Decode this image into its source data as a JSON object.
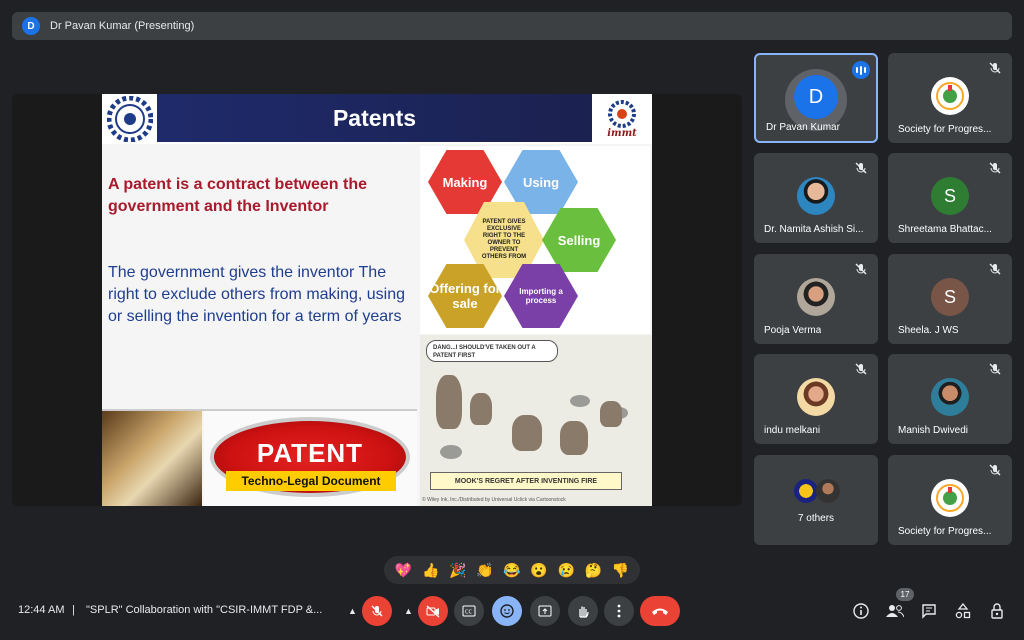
{
  "presenting_bar": {
    "avatar_letter": "D",
    "label": "Dr Pavan Kumar (Presenting)"
  },
  "slide": {
    "title": "Patents",
    "logo_right_text": "immt",
    "definition": "A patent is a contract between the government and the Inventor",
    "description": "The government gives the inventor The right to exclude others from making, using or selling the invention for a term of years",
    "hexagons": [
      {
        "label": "Making",
        "color": "#e53935"
      },
      {
        "label": "Using",
        "color": "#7ab3e8"
      },
      {
        "label": "Selling",
        "color": "#6abf3e"
      },
      {
        "label": "Offering for sale",
        "color": "#c9a227"
      },
      {
        "label": "Importing a process",
        "color": "#7b3fa8"
      }
    ],
    "hex_center": "PATENT GIVES EXCLUSIVE RIGHT TO THE OWNER TO PREVENT OTHERS FROM",
    "cartoon_bubble": "DANG...I SHOULD'VE TAKEN OUT A PATENT FIRST",
    "cartoon_caption": "MOOK'S REGRET AFTER INVENTING FIRE",
    "cartoon_credit": "© Wiley Ink, Inc./Distributed by Universal Uclick via Cartoonstock",
    "patent_badge": "PATENT",
    "patent_subtitle": "Techno-Legal Document"
  },
  "participants": [
    {
      "name": "Dr Pavan Kumar",
      "initial": "D",
      "avatar_color": "#1a73e8",
      "speaking": true
    },
    {
      "name": "Society for Progres...",
      "type": "logo",
      "muted": true
    },
    {
      "name": "Dr. Namita Ashish Si...",
      "type": "photo",
      "muted": true
    },
    {
      "name": "Shreetama Bhattac...",
      "initial": "S",
      "avatar_color": "#2e7d32",
      "muted": true
    },
    {
      "name": "Pooja Verma",
      "type": "photo",
      "muted": true
    },
    {
      "name": "Sheela. J WS",
      "initial": "S",
      "avatar_color": "#795548",
      "muted": true
    },
    {
      "name": "indu melkani",
      "type": "photo",
      "muted": true
    },
    {
      "name": "Manish Dwivedi",
      "type": "photo",
      "muted": true
    },
    {
      "name": "7 others",
      "type": "group"
    },
    {
      "name": "Society for Progres...",
      "type": "logo",
      "muted": true
    }
  ],
  "reactions": [
    "💖",
    "👍",
    "🎉",
    "👏",
    "😂",
    "😮",
    "😢",
    "🤔",
    "👎"
  ],
  "bottom_bar": {
    "time": "12:44 AM",
    "separator": "|",
    "meeting_title": "\"SPLR\" Collaboration with \"CSIR-IMMT FDP &...",
    "participant_count": "17",
    "colors": {
      "mic_off": "#ea4335",
      "end_call": "#ea4335",
      "captions_active": "#8ab4f8"
    }
  }
}
